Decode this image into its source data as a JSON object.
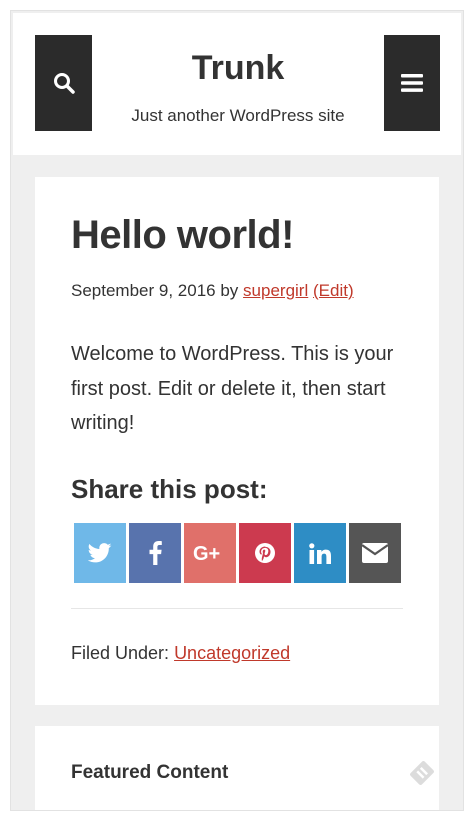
{
  "header": {
    "site_title": "Trunk",
    "site_description": "Just another WordPress site",
    "search_icon": "search-icon",
    "menu_icon": "hamburger-menu-icon"
  },
  "post": {
    "title": "Hello world!",
    "date": "September 9, 2016",
    "by_text": "by",
    "author": "supergirl",
    "edit_label": "(Edit)",
    "content": "Welcome to WordPress. This is your first post. Edit or delete it, then start writing!",
    "share_title": "Share this post:",
    "share_buttons": [
      {
        "network": "twitter",
        "icon": "twitter-icon",
        "color": "#6fb8e8"
      },
      {
        "network": "facebook",
        "icon": "facebook-icon",
        "color": "#5873ad"
      },
      {
        "network": "google-plus",
        "icon": "google-plus-icon",
        "color": "#e0706a"
      },
      {
        "network": "pinterest",
        "icon": "pinterest-icon",
        "color": "#cc3a4f"
      },
      {
        "network": "linkedin",
        "icon": "linkedin-icon",
        "color": "#2e8dc5"
      },
      {
        "network": "email",
        "icon": "envelope-icon",
        "color": "#555555"
      }
    ],
    "filed_under_label": "Filed Under:",
    "category": "Uncategorized"
  },
  "widget": {
    "title": "Featured Content",
    "icon": "featured-tag-icon"
  },
  "colors": {
    "link": "#c0392b",
    "header_button": "#2b2b2b",
    "page_background": "#efefef"
  }
}
